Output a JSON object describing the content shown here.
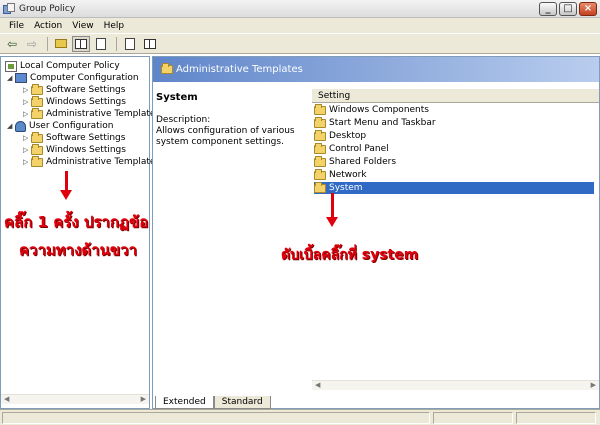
{
  "window": {
    "title": "Group Policy"
  },
  "menu": [
    "File",
    "Action",
    "View",
    "Help"
  ],
  "toolbar": {
    "buttons": [
      "back-icon",
      "forward-icon",
      "up-folder-icon",
      "show-hide-tree-icon",
      "export-list-icon",
      "properties-icon",
      "help-icon"
    ]
  },
  "tree": {
    "items": [
      {
        "label": "Local Computer Policy",
        "icon": "policy-icon",
        "level": 0
      },
      {
        "label": "Computer Configuration",
        "icon": "computer-icon",
        "level": 1
      },
      {
        "label": "Software Settings",
        "icon": "folder-icon",
        "level": 2
      },
      {
        "label": "Windows Settings",
        "icon": "folder-icon",
        "level": 2
      },
      {
        "label": "Administrative Templates",
        "icon": "folder-icon",
        "level": 2
      },
      {
        "label": "User Configuration",
        "icon": "user-icon",
        "level": 1
      },
      {
        "label": "Software Settings",
        "icon": "folder-icon",
        "level": 2
      },
      {
        "label": "Windows Settings",
        "icon": "folder-icon",
        "level": 2
      },
      {
        "label": "Administrative Templates",
        "icon": "folder-icon",
        "level": 2
      }
    ]
  },
  "annotations": {
    "left_line1": "คลิ๊ก 1 ครั้ง ปรากฏข้อ",
    "left_line2": "ความทางด้านขวา",
    "right": "ดับเบิ้ลคลิ๊กที่ system",
    "color": "#e0000c"
  },
  "right_pane": {
    "header": "Administrative Templates",
    "selected_title": "System",
    "description_label": "Description:",
    "description_text": "Allows configuration of various system component settings.",
    "column_header": "Setting",
    "items": [
      {
        "label": "Windows Components",
        "selected": false
      },
      {
        "label": "Start Menu and Taskbar",
        "selected": false
      },
      {
        "label": "Desktop",
        "selected": false
      },
      {
        "label": "Control Panel",
        "selected": false
      },
      {
        "label": "Shared Folders",
        "selected": false
      },
      {
        "label": "Network",
        "selected": false
      },
      {
        "label": "System",
        "selected": true
      }
    ],
    "selection_color": "#316ac5"
  },
  "tabs": [
    {
      "label": "Extended",
      "active": true
    },
    {
      "label": "Standard",
      "active": false
    }
  ]
}
